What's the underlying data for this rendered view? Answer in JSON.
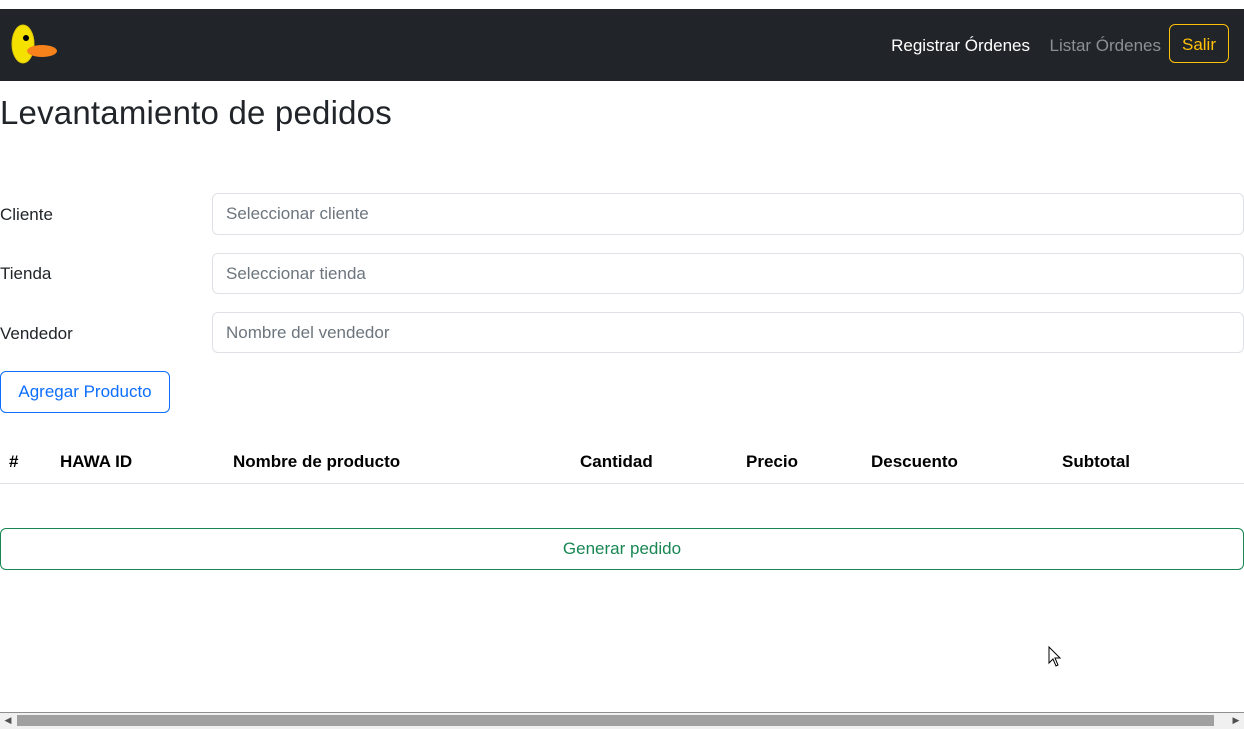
{
  "navbar": {
    "logo_icon": "duck-logo-icon",
    "links": {
      "register": "Registrar Órdenes",
      "list": "Listar Órdenes"
    },
    "logout_label": "Salir",
    "colors": {
      "bg": "#212529",
      "logout": "#ffc107",
      "inactive_link": "#8c9096"
    }
  },
  "page": {
    "title": "Levantamiento de pedidos"
  },
  "form": {
    "client": {
      "label": "Cliente",
      "placeholder": "Seleccionar cliente",
      "value": ""
    },
    "store": {
      "label": "Tienda",
      "placeholder": "Seleccionar tienda",
      "value": ""
    },
    "seller": {
      "label": "Vendedor",
      "placeholder": "Nombre del vendedor",
      "value": ""
    }
  },
  "actions": {
    "add_product_label": "Agregar Producto",
    "generate_order_label": "Generar pedido",
    "colors": {
      "add": "#0d6efd",
      "generate": "#198754"
    }
  },
  "table": {
    "headers": [
      "#",
      "HAWA ID",
      "Nombre de producto",
      "Cantidad",
      "Precio",
      "Descuento",
      "Subtotal"
    ],
    "rows": []
  },
  "scrollbar": {
    "left_icon": "scroll-left-arrow-icon",
    "right_icon": "scroll-right-arrow-icon"
  }
}
